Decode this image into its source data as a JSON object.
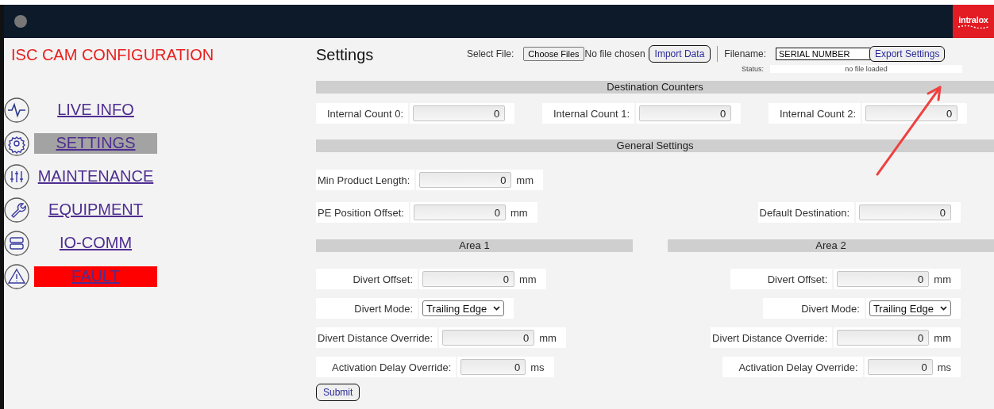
{
  "header": {
    "logo": "intralox"
  },
  "app_title": "ISC CAM CONFIGURATION",
  "nav": [
    {
      "label": "LIVE INFO",
      "selected": false,
      "kind": "link"
    },
    {
      "label": "SETTINGS",
      "selected": true,
      "kind": "link"
    },
    {
      "label": "MAINTENANCE",
      "selected": false,
      "kind": "link"
    },
    {
      "label": "EQUIPMENT",
      "selected": false,
      "kind": "link"
    },
    {
      "label": "IO-COMM",
      "selected": false,
      "kind": "link"
    },
    {
      "label": "FAULT",
      "selected": false,
      "kind": "alert"
    }
  ],
  "page_title": "Settings",
  "file": {
    "select_label": "Select File:",
    "choose_button": "Choose Files",
    "chosen": "No file chosen",
    "import_button": "Import Data",
    "filename_label": "Filename:",
    "filename_value": "SERIAL NUMBER",
    "export_button": "Export Settings",
    "status_label": "Status:",
    "status_value": "no file loaded"
  },
  "destination_counters": {
    "title": "Destination Counters",
    "fields": [
      {
        "label": "Internal Count 0:",
        "value": "0"
      },
      {
        "label": "Internal Count 1:",
        "value": "0"
      },
      {
        "label": "Internal Count 2:",
        "value": "0"
      }
    ]
  },
  "general_settings": {
    "title": "General Settings",
    "rows": [
      {
        "left": {
          "label": "Min Product Length:",
          "value": "0",
          "unit": "mm"
        }
      },
      {
        "left": {
          "label": "PE Position Offset:",
          "value": "0",
          "unit": "mm"
        },
        "right": {
          "label": "Default Destination:",
          "value": "0"
        }
      }
    ]
  },
  "areas": [
    {
      "title": "Area 1",
      "fields": [
        {
          "kind": "number",
          "label": "Divert Offset:",
          "value": "0",
          "unit": "mm"
        },
        {
          "kind": "select",
          "label": "Divert Mode:",
          "value": "Trailing Edge"
        },
        {
          "kind": "number",
          "label": "Divert Distance Override:",
          "value": "0",
          "unit": "mm"
        },
        {
          "kind": "number",
          "label": "Activation Delay Override:",
          "value": "0",
          "unit": "ms"
        }
      ]
    },
    {
      "title": "Area 2",
      "fields": [
        {
          "kind": "number",
          "label": "Divert Offset:",
          "value": "0",
          "unit": "mm"
        },
        {
          "kind": "select",
          "label": "Divert Mode:",
          "value": "Trailing Edge"
        },
        {
          "kind": "number",
          "label": "Divert Distance Override:",
          "value": "0",
          "unit": "mm"
        },
        {
          "kind": "number",
          "label": "Activation Delay Override:",
          "value": "0",
          "unit": "ms"
        }
      ]
    }
  ],
  "submit_button": "Submit"
}
